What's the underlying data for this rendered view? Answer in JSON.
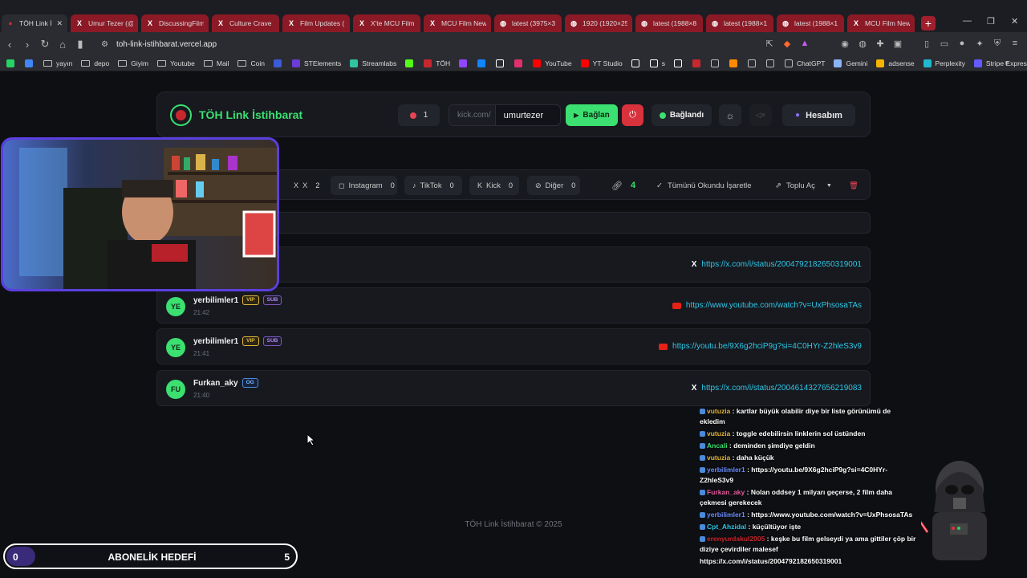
{
  "browser": {
    "tabs": [
      {
        "label": "TÖH Link İ",
        "icon": "brand-icon",
        "active": true
      },
      {
        "label": "Umur Tezer (@",
        "icon": "x-icon"
      },
      {
        "label": "DiscussingFilm",
        "icon": "x-icon"
      },
      {
        "label": "Culture Crave",
        "icon": "x-icon"
      },
      {
        "label": "Film Updates (",
        "icon": "x-icon"
      },
      {
        "label": "X'te MCU Film",
        "icon": "x-icon"
      },
      {
        "label": "MCU Film New",
        "icon": "x-icon"
      },
      {
        "label": "latest (3975×3",
        "icon": "globe-icon"
      },
      {
        "label": "1920 (1920×25",
        "icon": "globe-icon"
      },
      {
        "label": "latest (1988×8",
        "icon": "globe-icon"
      },
      {
        "label": "latest (1988×1",
        "icon": "globe-icon"
      },
      {
        "label": "latest (1988×1",
        "icon": "globe-icon"
      },
      {
        "label": "MCU Film New",
        "icon": "x-icon"
      }
    ],
    "url": "toh-link-istihbarat.vercel.app",
    "bookmarks": [
      {
        "label": "",
        "icon": "whatsapp-icon",
        "color": "#25d366"
      },
      {
        "label": "",
        "icon": "google-icon",
        "color": "#4285f4"
      },
      {
        "label": "yayın",
        "icon": "folder-icon"
      },
      {
        "label": "depo",
        "icon": "folder-icon"
      },
      {
        "label": "Giyim",
        "icon": "folder-icon"
      },
      {
        "label": "Youtube",
        "icon": "folder-icon"
      },
      {
        "label": "Mail",
        "icon": "folder-icon"
      },
      {
        "label": "Coin",
        "icon": "folder-icon"
      },
      {
        "label": "",
        "icon": "r-icon",
        "color": "#3c5bd8"
      },
      {
        "label": "STElements",
        "icon": "st-icon",
        "color": "#6a3cd8"
      },
      {
        "label": "Streamlabs",
        "icon": "streamlabs-icon",
        "color": "#31c3a2"
      },
      {
        "label": "",
        "icon": "kick-icon",
        "color": "#53fc18"
      },
      {
        "label": "TÖH",
        "icon": "brand-icon",
        "color": "#c7282e"
      },
      {
        "label": "",
        "icon": "twitch-icon",
        "color": "#9146ff"
      },
      {
        "label": "",
        "icon": "bluesky-icon",
        "color": "#1185fe"
      },
      {
        "label": "",
        "icon": "x-icon",
        "color": "#ffffff"
      },
      {
        "label": "",
        "icon": "instagram-icon",
        "color": "#e1306c"
      },
      {
        "label": "YouTube",
        "icon": "youtube-icon",
        "color": "#ff0000"
      },
      {
        "label": "YT Studio",
        "icon": "youtube-icon",
        "color": "#ff0000"
      },
      {
        "label": "",
        "icon": "tiktok-icon",
        "color": "#ffffff"
      },
      {
        "label": "s",
        "icon": "tiktok-icon",
        "color": "#ffffff"
      },
      {
        "label": "",
        "icon": "circle-icon",
        "color": "#ffffff"
      },
      {
        "label": "",
        "icon": "bookmark-red-icon",
        "color": "#c7282e"
      },
      {
        "label": "",
        "icon": "square-icon",
        "color": "#bbbbbb"
      },
      {
        "label": "",
        "icon": "orange-icon",
        "color": "#ff8a00"
      },
      {
        "label": "",
        "icon": "square-icon",
        "color": "#bbbbbb"
      },
      {
        "label": "",
        "icon": "grid-icon",
        "color": "#bbbbbb"
      },
      {
        "label": "ChatGPT",
        "icon": "chatgpt-icon",
        "color": "#bbbbbb"
      },
      {
        "label": "Gemini",
        "icon": "gemini-icon",
        "color": "#8ab4f8"
      },
      {
        "label": "adsense",
        "icon": "adsense-icon",
        "color": "#f4b400"
      },
      {
        "label": "Perplexity",
        "icon": "perplexity-icon",
        "color": "#20b8cd"
      },
      {
        "label": "Stripe Express",
        "icon": "stripe-icon",
        "color": "#635bff"
      }
    ]
  },
  "header": {
    "title": "TÖH Link İstihbarat",
    "notif_count": "1",
    "input_prefix": "kick.com/",
    "input_value": "umurtezer",
    "connect_label": "Bağlan",
    "status_label": "Bağlandı",
    "account_label": "Hesabım"
  },
  "filters": {
    "items": [
      {
        "label": "X",
        "count": "2",
        "icon": "x-icon"
      },
      {
        "label": "Instagram",
        "count": "0",
        "icon": "instagram-icon"
      },
      {
        "label": "TikTok",
        "count": "0",
        "icon": "tiktok-icon"
      },
      {
        "label": "Kick",
        "count": "0",
        "icon": "kick-icon"
      },
      {
        "label": "Diğer",
        "count": "0",
        "icon": "link-icon"
      }
    ],
    "total_count": "4",
    "mark_all_read": "Tümünü Okundu İşaretle",
    "bulk_open": "Toplu Aç"
  },
  "links": [
    {
      "initials": "",
      "user": "",
      "time": "",
      "badges": [],
      "source": "x",
      "url": "https://x.com/i/status/2004792182650319001"
    },
    {
      "initials": "YE",
      "user": "yerbilimler1",
      "time": "21:42",
      "badges": [
        "VIP",
        "SUB"
      ],
      "source": "youtube",
      "url": "https://www.youtube.com/watch?v=UxPhsosaTAs"
    },
    {
      "initials": "YE",
      "user": "yerbilimler1",
      "time": "21:41",
      "badges": [
        "VIP",
        "SUB"
      ],
      "source": "youtube",
      "url": "https://youtu.be/9X6g2hciP9g?si=4C0HYr-Z2hleS3v9"
    },
    {
      "initials": "FU",
      "user": "Furkan_aky",
      "time": "21:40",
      "badges": [
        "OG"
      ],
      "source": "x",
      "url": "https://x.com/i/status/2004614327656219083"
    }
  ],
  "footer": "TÖH Link İstihbarat © 2025",
  "goal": {
    "current": "0",
    "label": "ABONELİK HEDEFİ",
    "target": "5",
    "progress": 0
  },
  "chat": [
    {
      "user": "vutuzia",
      "color": "#e0b73a",
      "text": ": kartlar büyük olabilir diye bir liste görünümü de ekledim"
    },
    {
      "user": "vutuzia",
      "color": "#e0b73a",
      "text": ": toggle edebilirsin linklerin sol üstünden"
    },
    {
      "user": "Ancali",
      "color": "#3be070",
      "text": ": deminden şimdiye geldin"
    },
    {
      "user": "vutuzia",
      "color": "#e0b73a",
      "text": ": daha küçük"
    },
    {
      "user": "yerbilimler1",
      "color": "#6a8cff",
      "text": ": https://youtu.be/9X6g2hciP9g?si=4C0HYr-Z2hleS3v9"
    },
    {
      "user": "Furkan_aky",
      "color": "#e65fa0",
      "text": ": Nolan oddsey 1 milyarı geçerse, 2 film daha çekmesi gerekecek"
    },
    {
      "user": "yerbilimler1",
      "color": "#6a8cff",
      "text": ": https://www.youtube.com/watch?v=UxPhsosaTAs"
    },
    {
      "user": "Cpt_Ahzidal",
      "color": "#2ec7e6",
      "text": ": küçültüyor işte"
    },
    {
      "user": "erenyurdakul2005",
      "color": "#c7282e",
      "text": ": keşke bu film gelseydi ya ama gittiler çöp bir diziye çevirdiler malesef"
    },
    {
      "user": "",
      "color": "#ffffff",
      "text": "https://x.com/i/status/2004792182650319001"
    }
  ]
}
